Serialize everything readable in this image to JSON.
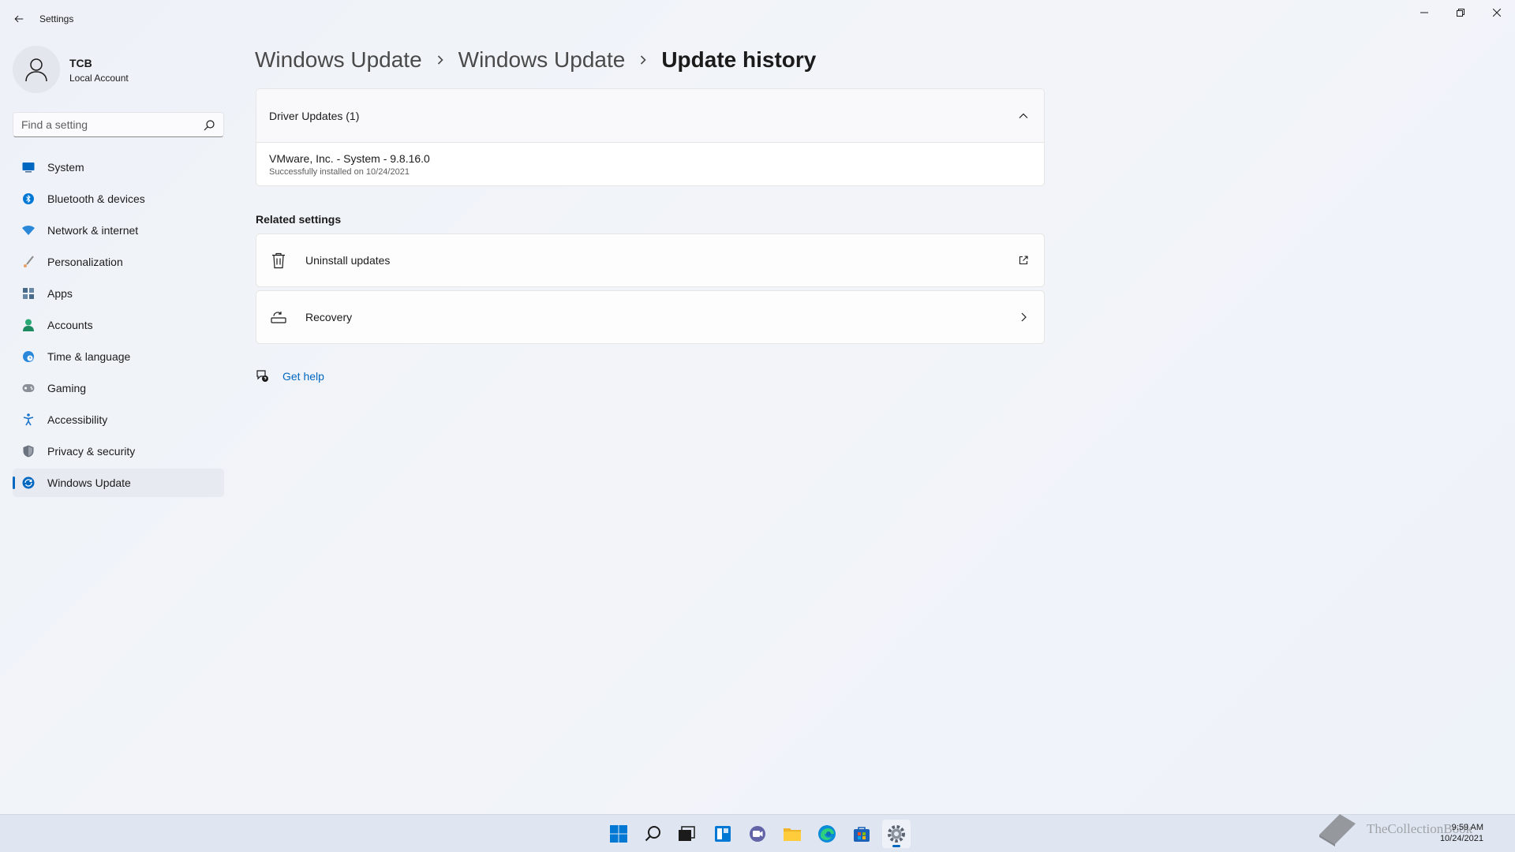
{
  "window": {
    "app_title": "Settings"
  },
  "profile": {
    "name": "TCB",
    "account_type": "Local Account"
  },
  "search": {
    "placeholder": "Find a setting"
  },
  "sidebar": {
    "items": [
      {
        "label": "System",
        "icon": "system-icon",
        "color": "#0067c0"
      },
      {
        "label": "Bluetooth & devices",
        "icon": "bluetooth-icon",
        "color": "#0078d4"
      },
      {
        "label": "Network & internet",
        "icon": "wifi-icon",
        "color": "#2b88d8"
      },
      {
        "label": "Personalization",
        "icon": "brush-icon",
        "color": "#c2703d"
      },
      {
        "label": "Apps",
        "icon": "apps-icon",
        "color": "#4a6a8c"
      },
      {
        "label": "Accounts",
        "icon": "person-icon",
        "color": "#2aa876"
      },
      {
        "label": "Time & language",
        "icon": "globe-clock-icon",
        "color": "#2b88d8"
      },
      {
        "label": "Gaming",
        "icon": "gamepad-icon",
        "color": "#7a7a7a"
      },
      {
        "label": "Accessibility",
        "icon": "accessibility-icon",
        "color": "#1a73c9"
      },
      {
        "label": "Privacy & security",
        "icon": "shield-icon",
        "color": "#6b7280"
      },
      {
        "label": "Windows Update",
        "icon": "update-icon",
        "color": "#0067c0",
        "active": true
      }
    ]
  },
  "breadcrumb": {
    "items": [
      "Windows Update",
      "Windows Update"
    ],
    "current": "Update history"
  },
  "driver_updates": {
    "header": "Driver Updates (1)",
    "expanded": true,
    "entries": [
      {
        "name": "VMware, Inc. - System - 9.8.16.0",
        "status": "Successfully installed on 10/24/2021"
      }
    ]
  },
  "related_settings": {
    "title": "Related settings",
    "items": [
      {
        "label": "Uninstall updates",
        "icon": "trash-icon",
        "end_icon": "external-link-icon"
      },
      {
        "label": "Recovery",
        "icon": "recovery-icon",
        "end_icon": "chevron-right-icon"
      }
    ]
  },
  "help": {
    "label": "Get help"
  },
  "taskbar": {
    "apps": [
      "start-icon",
      "search-icon",
      "task-view-icon",
      "widgets-icon",
      "chat-icon",
      "file-explorer-icon",
      "edge-icon",
      "store-icon",
      "settings-icon"
    ],
    "active_app": "settings-icon"
  },
  "watermark": {
    "text": "TheCollectionBook"
  },
  "clock": {
    "time": "9:59 AM",
    "date": "10/24/2021"
  },
  "colors": {
    "accent": "#0067c0",
    "background": "#eef2f8"
  }
}
